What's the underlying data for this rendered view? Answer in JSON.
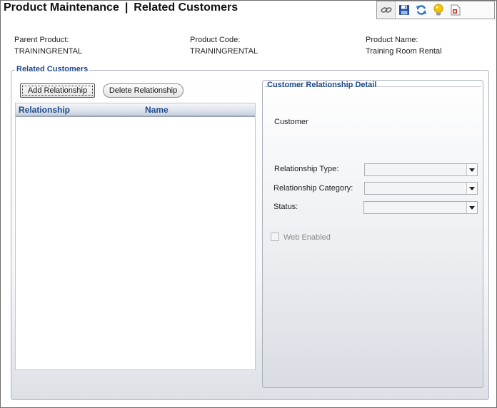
{
  "header": {
    "title": "Product Maintenance",
    "separator": "|",
    "subtitle": "Related Customers"
  },
  "toolbar": {
    "items": [
      {
        "name": "link-icon"
      },
      {
        "name": "save-icon"
      },
      {
        "name": "refresh-icon"
      },
      {
        "name": "lightbulb-icon"
      },
      {
        "name": "report-icon"
      }
    ]
  },
  "info": {
    "parent_product_label": "Parent Product:",
    "parent_product_value": "TRAININGRENTAL",
    "product_code_label": "Product Code:",
    "product_code_value": "TRAININGRENTAL",
    "product_name_label": "Product Name:",
    "product_name_value": "Training Room Rental"
  },
  "related": {
    "legend": "Related Customers",
    "add_button": "Add Relationship",
    "delete_button": "Delete Relationship",
    "columns": [
      "Relationship",
      "Name"
    ],
    "rows": []
  },
  "detail": {
    "legend": "Customer Relationship Detail",
    "customer_label": "Customer",
    "relationship_type_label": "Relationship Type:",
    "relationship_type_value": "",
    "relationship_category_label": "Relationship Category:",
    "relationship_category_value": "",
    "status_label": "Status:",
    "status_value": "",
    "web_enabled_label": "Web Enabled",
    "web_enabled_checked": false
  },
  "colors": {
    "accent": "#1e4b8a",
    "panel_border": "#a9b4c2"
  }
}
